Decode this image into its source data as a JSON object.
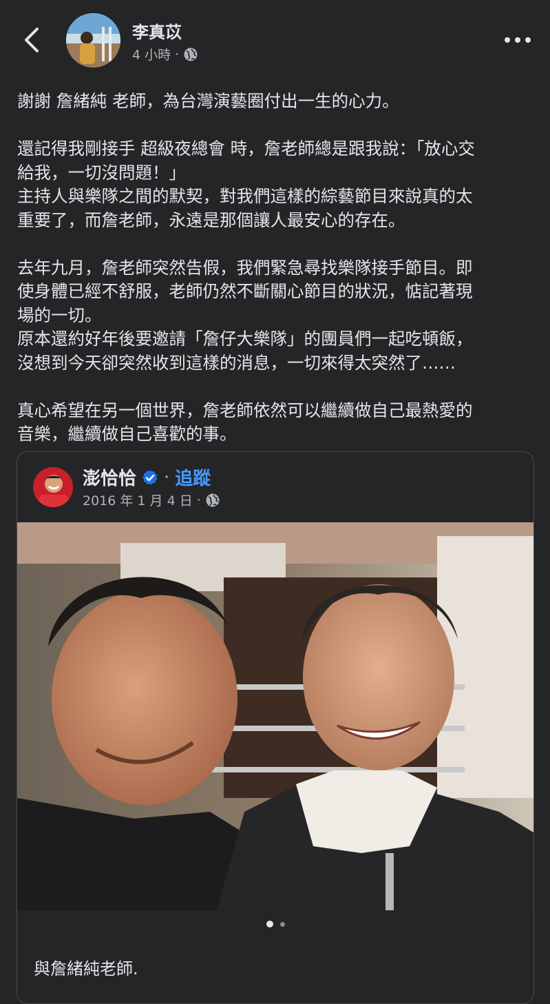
{
  "header": {
    "author_name": "李真苡",
    "time": "4 小時",
    "separator": "·",
    "privacy_icon": "globe-icon",
    "back_icon": "chevron-left-icon",
    "more_icon": "more-dots-icon"
  },
  "post": {
    "lines": [
      "謝謝 詹緒純 老師，為台灣演藝圈付出一生的心力。",
      "",
      "還記得我剛接手 超級夜總會 時，詹老師總是跟我說：「放心交",
      "給我，一切沒問題！」",
      "主持人與樂隊之間的默契，對我們這樣的綜藝節目來說真的太",
      "重要了，而詹老師，永遠是那個讓人最安心的存在。",
      "",
      "去年九月，詹老師突然告假，我們緊急尋找樂隊接手節目。即",
      "使身體已經不舒服，老師仍然不斷關心節目的狀況，惦記著現",
      "場的一切。",
      "原本還約好年後要邀請「詹仔大樂隊」的團員們一起吃頓飯，",
      "沒想到今天卻突然收到這樣的消息，一切來得太突然了……",
      "",
      "真心希望在另一個世界，詹老師依然可以繼續做自己最熱愛的",
      "音樂，繼續做自己喜歡的事。"
    ]
  },
  "shared_post": {
    "author_name": "澎恰恰",
    "verified_icon": "verified-badge-icon",
    "separator": "·",
    "follow_label": "追蹤",
    "date": "2016 年 1 月 4 日",
    "privacy_icon": "globe-icon",
    "photo_icon": "photo-two-men-smiling",
    "caption": "與詹緒純老師.",
    "carousel": {
      "current": 1,
      "total": 2
    }
  },
  "colors": {
    "background": "#242526",
    "text": "#e4e6eb",
    "secondary_text": "#b0b3b8",
    "link": "#4599ff",
    "verified": "#1b74e4"
  }
}
